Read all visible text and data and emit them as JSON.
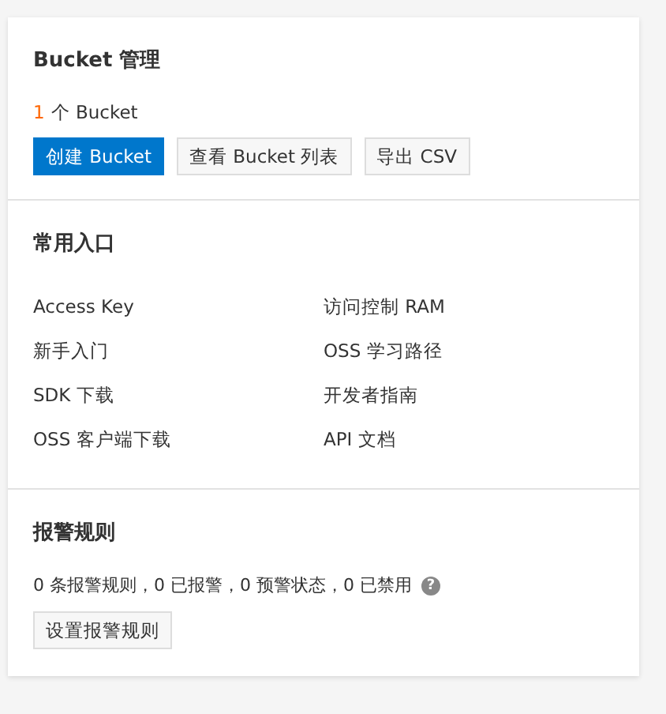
{
  "bucket_section": {
    "title": "Bucket 管理",
    "count": "1",
    "count_label": "个 Bucket",
    "buttons": [
      {
        "label": "创建 Bucket",
        "kind": "primary"
      },
      {
        "label": "查看 Bucket 列表",
        "kind": "default"
      },
      {
        "label": "导出 CSV",
        "kind": "default"
      }
    ]
  },
  "shortcuts_section": {
    "title": "常用入口",
    "links": [
      "Access Key",
      "访问控制 RAM",
      "新手入门",
      "OSS 学习路径",
      "SDK 下载",
      "开发者指南",
      "OSS 客户端下载",
      "API 文档"
    ]
  },
  "alarm_section": {
    "title": "报警规则",
    "summary": "0 条报警规则，0 已报警，0 预警状态，0 已禁用",
    "help_icon": "?",
    "button": "设置报警规则"
  }
}
